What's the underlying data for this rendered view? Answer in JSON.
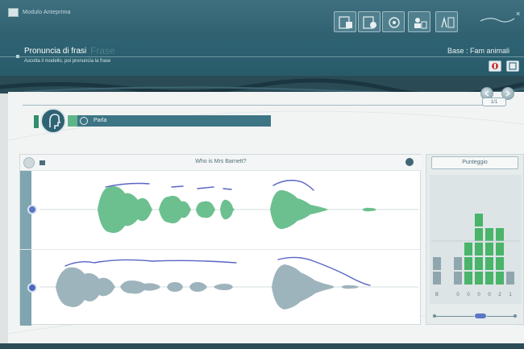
{
  "window": {
    "app_title": "Modulo Anteprima",
    "logo": "reflex-logo"
  },
  "toolbar": {
    "icons": [
      "sentence-list-icon",
      "sentence-edit-icon",
      "settings-icon",
      "users-icon",
      "stats-icon",
      "logo-icon"
    ]
  },
  "header": {
    "title": "Pronuncia di frasi",
    "title_ghost": "Frase",
    "subtitle": "Ascolta il modello, poi pronuncia la frase",
    "base": "Base : Fam animali"
  },
  "controls": {
    "counter": "1/1"
  },
  "speaker": {
    "label": "Parla"
  },
  "waveform": {
    "phrase": "Who is Mrs Barnett?",
    "tracks": [
      {
        "name": "student-recording",
        "color": "#6cc08f"
      },
      {
        "name": "model-recording",
        "color": "#9eb4bc"
      }
    ]
  },
  "score": {
    "button_label": "Punteggio",
    "bars": [
      {
        "label": "B",
        "value": 2,
        "color": "#8fa6ae"
      },
      {
        "label": "",
        "value": 0,
        "color": "#8fa6ae"
      },
      {
        "label": "0",
        "value": 2,
        "color": "#8fa6ae"
      },
      {
        "label": "0",
        "value": 3,
        "color": "#49b46a"
      },
      {
        "label": "0",
        "value": 5,
        "color": "#49b46a"
      },
      {
        "label": "0",
        "value": 4,
        "color": "#49b46a"
      },
      {
        "label": "2",
        "value": 4,
        "color": "#49b46a"
      },
      {
        "label": "1",
        "value": 1,
        "color": "#8fa6ae"
      }
    ]
  },
  "colors": {
    "header_bg": "#2e6373",
    "accent_green": "#5fb58a",
    "accent_blue": "#5a76c4"
  }
}
